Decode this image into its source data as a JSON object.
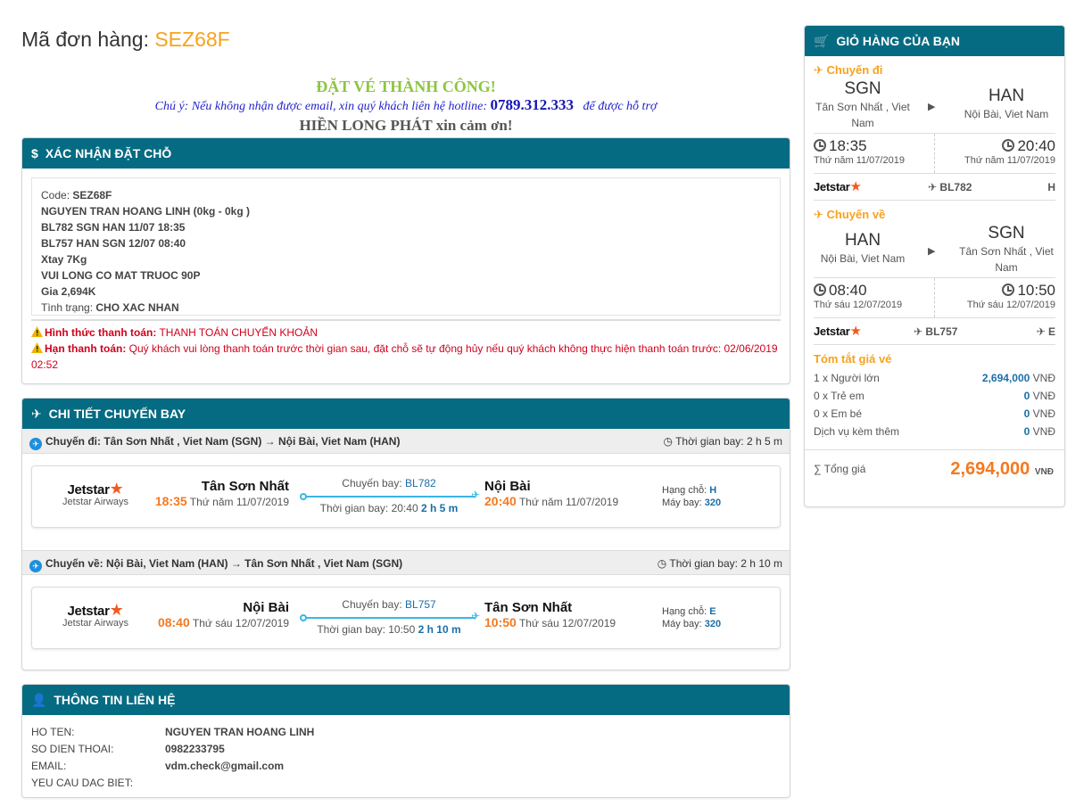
{
  "order": {
    "label": "Mã đơn hàng:",
    "code": "SEZ68F"
  },
  "success": {
    "title": "ĐẶT VÉ THÀNH CÔNG!",
    "note_pre": "Chú ý: Nếu không nhận được email, xin quý khách liên hệ hotline:",
    "hotline": "0789.312.333",
    "note_post": "để được hỗ trợ",
    "thanks": "HIỀN LONG PHÁT xin cảm ơn!"
  },
  "booking": {
    "header": "XÁC NHẬN ĐẶT CHỖ",
    "code_label": "Code:",
    "code_value": "SEZ68F",
    "lines": [
      "NGUYEN TRAN HOANG LINH (0kg - 0kg )",
      "BL782 SGN HAN 11/07 18:35",
      "BL757 HAN SGN 12/07 08:40",
      "Xtay 7Kg",
      "VUI LONG CO MAT TRUOC 90P",
      "Gia 2,694K"
    ],
    "status_label": "Tình trạng:",
    "status_value": "CHO XAC NHAN",
    "pay_method_label": "Hình thức thanh toán:",
    "pay_method_value": "THANH TOÁN CHUYỂN KHOẢN",
    "deadline_label": "Hạn thanh toán:",
    "deadline_value": "Quý khách vui lòng thanh toán trước thời gian sau, đặt chỗ sẽ tự động hủy nếu quý khách không thực hiện thanh toán trước: 02/06/2019 02:52"
  },
  "flights": {
    "header": "CHI TIẾT CHUYẾN BAY",
    "legs": [
      {
        "bar": "Chuyến đi: Tân Sơn Nhất , Viet Nam (SGN) → Nội Bài, Viet Nam (HAN)",
        "duration_bar": "Thời gian bay: 2 h 5 m",
        "airline": "Jetstar",
        "airline_full": "Jetstar Airways",
        "dep_city": "Tân Sơn Nhất",
        "dep_time": "18:35",
        "dep_date": "Thứ năm 11/07/2019",
        "flight_label": "Chuyến bay:",
        "flight_no": "BL782",
        "duration_label": "Thời gian bay: 20:40",
        "duration": "2 h 5 m",
        "arr_city": "Nội Bài",
        "arr_time": "20:40",
        "arr_date": "Thứ năm 11/07/2019",
        "class_label": "Hạng chỗ:",
        "class": "H",
        "aircraft_label": "Máy bay:",
        "aircraft": "320"
      },
      {
        "bar": "Chuyến về: Nội Bài, Viet Nam (HAN) → Tân Sơn Nhất , Viet Nam (SGN)",
        "duration_bar": "Thời gian bay: 2 h 10 m",
        "airline": "Jetstar",
        "airline_full": "Jetstar Airways",
        "dep_city": "Nội Bài",
        "dep_time": "08:40",
        "dep_date": "Thứ sáu 12/07/2019",
        "flight_label": "Chuyến bay:",
        "flight_no": "BL757",
        "duration_label": "Thời gian bay: 10:50",
        "duration": "2 h 10 m",
        "arr_city": "Tân Sơn Nhất",
        "arr_time": "10:50",
        "arr_date": "Thứ sáu 12/07/2019",
        "class_label": "Hạng chỗ:",
        "class": "E",
        "aircraft_label": "Máy bay:",
        "aircraft": "320"
      }
    ]
  },
  "contact": {
    "header": "THÔNG TIN LIÊN HỆ",
    "rows": [
      {
        "k": "HO TEN:",
        "v": "NGUYEN TRAN HOANG LINH"
      },
      {
        "k": "SO DIEN THOAI:",
        "v": "0982233795"
      },
      {
        "k": "EMAIL:",
        "v": "vdm.check@gmail.com"
      },
      {
        "k": "YEU CAU DAC BIET:",
        "v": ""
      }
    ]
  },
  "cart": {
    "header": "GIỎ HÀNG CỦA BẠN",
    "outbound": {
      "title": "Chuyến đi",
      "from_code": "SGN",
      "from_name": "Tân Sơn Nhất , Viet Nam",
      "to_code": "HAN",
      "to_name": "Nội Bài, Viet Nam",
      "dep_time": "18:35",
      "dep_date": "Thứ năm 11/07/2019",
      "arr_time": "20:40",
      "arr_date": "Thứ năm 11/07/2019",
      "airline": "Jetstar",
      "flight": "BL782",
      "class": "H"
    },
    "inbound": {
      "title": "Chuyến về",
      "from_code": "HAN",
      "from_name": "Nội Bài, Viet Nam",
      "to_code": "SGN",
      "to_name": "Tân Sơn Nhất , Viet Nam",
      "dep_time": "08:40",
      "dep_date": "Thứ sáu 12/07/2019",
      "arr_time": "10:50",
      "arr_date": "Thứ sáu 12/07/2019",
      "airline": "Jetstar",
      "flight": "BL757",
      "class": "E"
    },
    "summary": {
      "title": "Tóm tắt giá vé",
      "rows": [
        {
          "k": "1 x Người lớn",
          "v": "2,694,000"
        },
        {
          "k": "0 x Trẻ em",
          "v": "0"
        },
        {
          "k": "0 x Em bé",
          "v": "0"
        },
        {
          "k": "Dịch vụ kèm thêm",
          "v": "0"
        }
      ],
      "currency": "VNĐ",
      "total_label": "∑ Tổng giá",
      "total_value": "2,694,000",
      "total_currency": "VNĐ"
    }
  },
  "colors": {
    "header": "#056b82",
    "accent": "#f7a21c",
    "time": "#f47920",
    "link": "#1b6ea8",
    "warn": "#d0021b"
  }
}
